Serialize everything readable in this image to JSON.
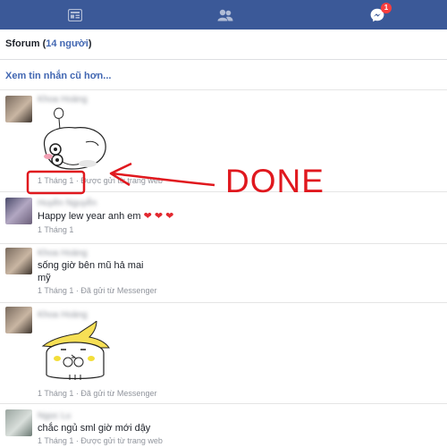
{
  "topbar": {
    "tabs": [
      {
        "icon": "news-feed-icon"
      },
      {
        "icon": "friends-icon"
      },
      {
        "icon": "messenger-icon",
        "badge": "1"
      }
    ],
    "bg": "#3b5998"
  },
  "group": {
    "name": "Sforum",
    "count": "14 người"
  },
  "older_link": "Xem tin nhắn cũ hơn...",
  "messages": [
    {
      "sender": "Khoa Hoàng",
      "text": "",
      "sticker": "sticker-blob-with-glasses",
      "meta": "1 Tháng 1 · Được gửi từ trang web"
    },
    {
      "sender": "Huyền Nguyễn",
      "text": "Happy lew year anh em",
      "meta": "1 Tháng 1"
    },
    {
      "sender": "Khoa Hoàng",
      "text": "sống giờ bên mũ hả mai",
      "text2": "mỹ",
      "meta": "1 Tháng 1 · Đã gửi từ Messenger"
    },
    {
      "sender": "Khoa Hoàng",
      "text": "",
      "sticker": "sticker-cat-with-banana-hat",
      "meta": "1 Tháng 1 · Đã gửi từ Messenger"
    },
    {
      "sender": "Ngọc Lu",
      "text": "chắc ngủ sml giờ mới dậy",
      "meta": "1 Tháng 1 · Được gửi từ trang web"
    }
  ],
  "annotation": {
    "label": "DONE",
    "color": "#e0181e"
  }
}
